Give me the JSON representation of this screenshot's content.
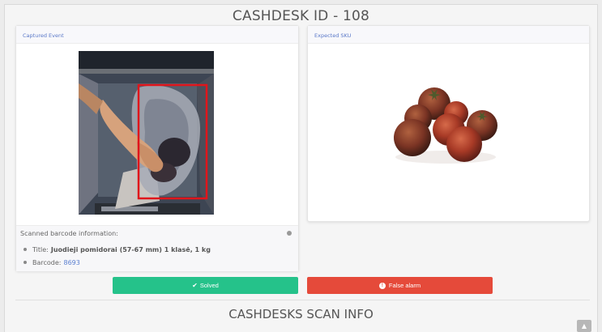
{
  "page": {
    "title": "CASHDESK ID - 108",
    "section_title": "CASHDESKS SCAN INFO"
  },
  "captured": {
    "header": "Captured Event"
  },
  "expected": {
    "header": "Expected SKU"
  },
  "scan_info": {
    "heading": "Scanned barcode information:",
    "title_label": "Title:",
    "title_value": "Juodieji pomidorai (57-67 mm) 1 klasė, 1 kg",
    "barcode_label": "Barcode:",
    "barcode_value": "8693"
  },
  "actions": {
    "solved_label": "Solved",
    "false_alarm_label": "False alarm"
  },
  "icons": {
    "solved": "check-icon",
    "false_alarm": "exclamation-circle-icon",
    "scroll_top": "chevron-up-icon",
    "info": "info-dot-icon"
  },
  "colors": {
    "solved": "#25c28a",
    "false_alarm": "#e54a3a",
    "header_text": "#5a78c8",
    "link": "#5b7fd0",
    "detection_box": "#e0151b"
  }
}
